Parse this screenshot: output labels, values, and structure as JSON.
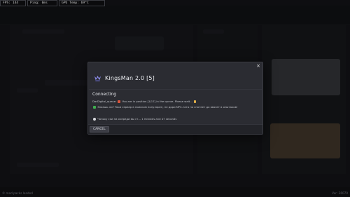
{
  "perf": {
    "fps": "FPS: 144",
    "ping": "Ping: 0ms",
    "gpu_temp": "GPU Temp: 69°C"
  },
  "footer": {
    "left": "© mod packs loaded",
    "right": "Ver: 26070"
  },
  "modal": {
    "title": "KingsMan 2.0  [5]",
    "close_glyph": "×",
    "status_title": "Connecting",
    "message_queue": "DarDigital_queue: ",
    "message_position": " You are in position [1/17] in the queue. Please wait... ",
    "message_tip": " Знаешь ли? Твои сервер в поиском популярен, не дори NPC-тата по спотеет до ввязет в опытаков!",
    "message_eta": " Чаньку ски на очереди вы ст... 1 minutes and 47 seconds",
    "cancel_label": "CANCEL"
  },
  "colors": {
    "modal_bg": "#2b2c32",
    "footer_bg": "#222328",
    "accent": "#6f6fd6"
  },
  "icons": {
    "logo": "kingsman-logo-icon",
    "close": "close-icon",
    "flag": "flag-emoji-icon",
    "hourglass": "hourglass-emoji-icon",
    "check": "check-emoji-icon",
    "clock": "clock-emoji-icon"
  }
}
